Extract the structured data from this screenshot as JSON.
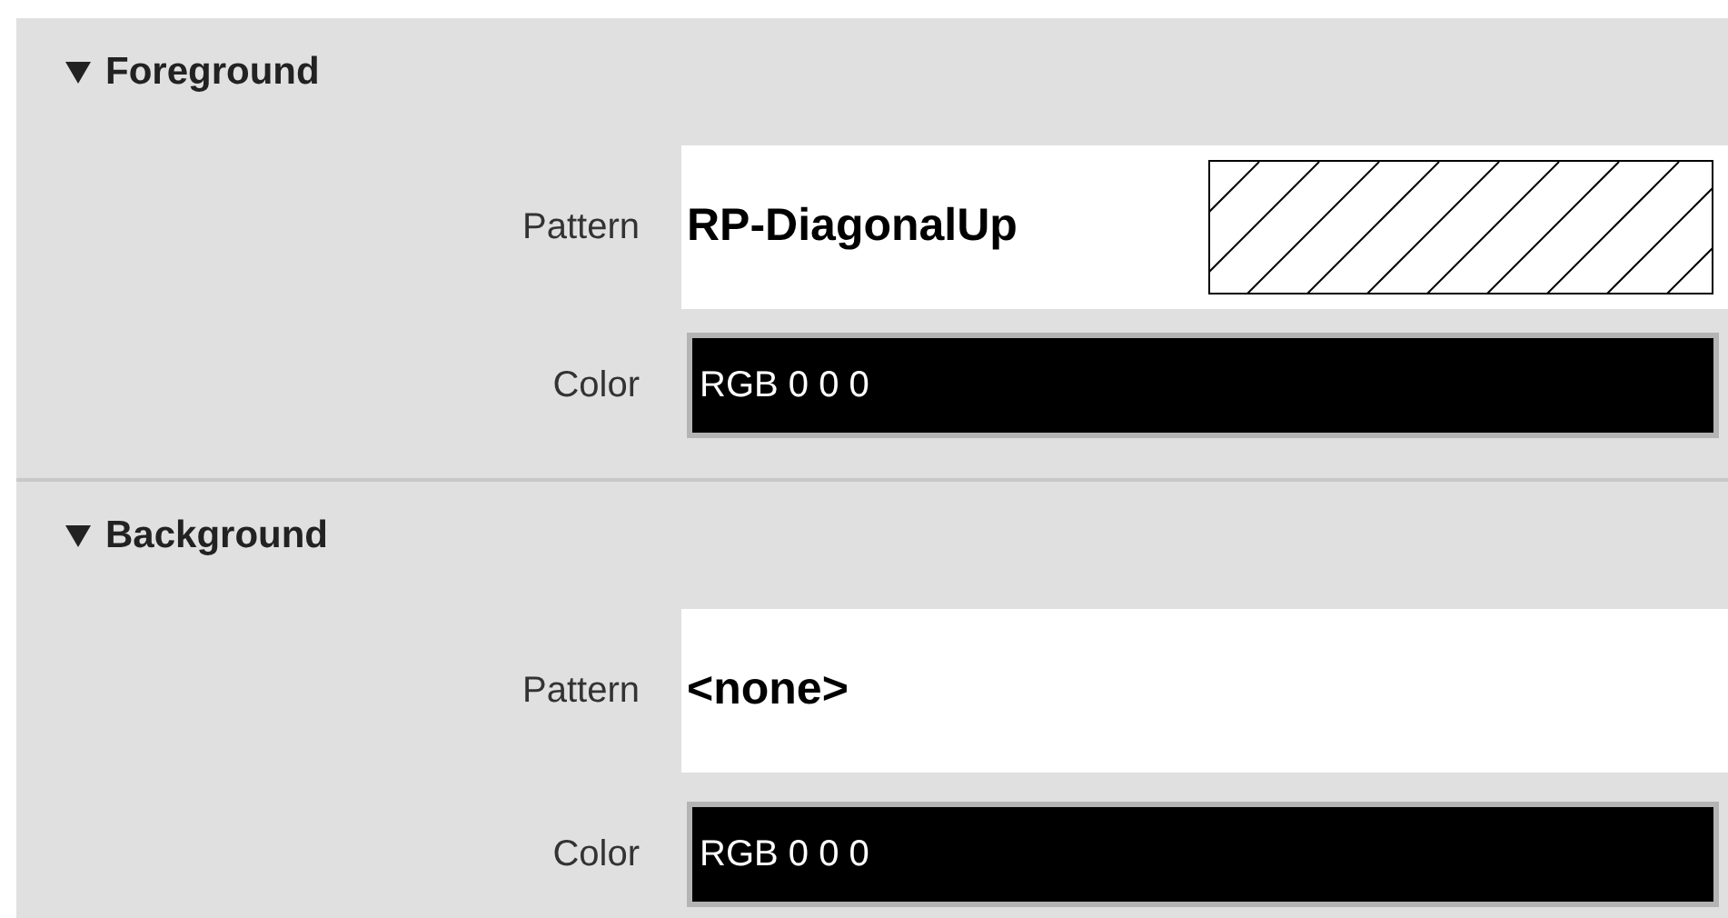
{
  "sections": [
    {
      "title": "Foreground",
      "expanded": true,
      "pattern": {
        "label": "Pattern",
        "value": "RP-DiagonalUp",
        "kind": "hatched"
      },
      "color": {
        "label": "Color",
        "value": "RGB 0 0 0",
        "color": "#000000"
      }
    },
    {
      "title": "Background",
      "expanded": true,
      "pattern": {
        "label": "Pattern",
        "value": "<none>",
        "kind": "plain"
      },
      "color": {
        "label": "Color",
        "value": "RGB 0 0 0",
        "color": "#000000"
      }
    }
  ]
}
